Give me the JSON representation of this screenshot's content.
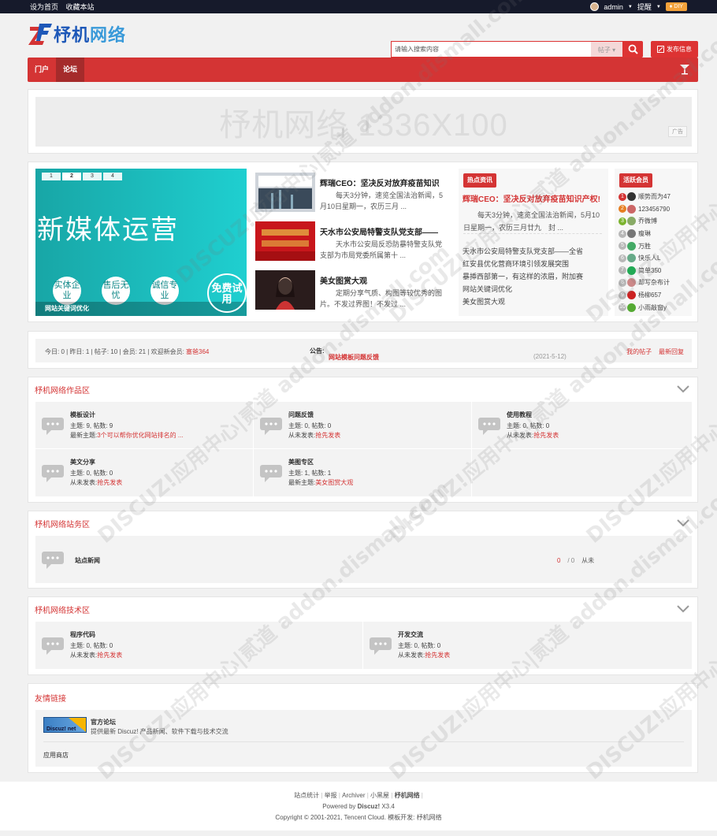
{
  "topbar": {
    "set_home": "设为首页",
    "bookmark": "收藏本站",
    "user": "admin",
    "remind": "提醒",
    "diy": "DIY"
  },
  "header": {
    "logo_text": "杼机",
    "logo_text2": "网络",
    "search_placeholder": "请输入搜索内容",
    "search_scope": "帖子",
    "post_button": "发布信息"
  },
  "nav": {
    "items": [
      "门户",
      "论坛"
    ]
  },
  "ad": {
    "text": "杼机网络 1336X100",
    "tag": "广告"
  },
  "banner": {
    "tabs": [
      "1",
      "2",
      "3",
      "4"
    ],
    "title": "新媒体运营",
    "c1": "实体企业",
    "c2": "售后无忧",
    "c3": "诚信专业",
    "free": "免费试用",
    "caption": "网站关键词优化"
  },
  "news": [
    {
      "title": "辉瑞CEO：坚决反对放弃疫苗知识",
      "desc": "每天3分钟，速览全国法治新闻，5月10日星期一，农历三月 ..."
    },
    {
      "title": "天水市公安局特警支队党支部——",
      "desc": "天水市公安局反恐防暴特警支队党支部为市局党委所属第十 ..."
    },
    {
      "title": "美女图赏大观",
      "desc": "定期分享气质、构图等较优秀的图片。不发过界图！不发过 ..."
    }
  ],
  "hot": {
    "tag": "热点资讯",
    "headline": "辉瑞CEO：坚决反对放弃疫苗知识产权!",
    "desc": "每天3分钟，速览全国法治新闻，5月10日星期一，农历三月廿九　封 ...",
    "links": [
      "天水市公安局特警支队党支部——全省",
      "红安县优化营商环境引领发展突围",
      "暴揷西部第一，有这样的浓眉，附加赛",
      "网站关键词优化",
      "美女图赏大观"
    ]
  },
  "members": {
    "tag": "活跃会员",
    "list": [
      {
        "n": "1",
        "name": "顺势而为47"
      },
      {
        "n": "2",
        "name": "123456790"
      },
      {
        "n": "3",
        "name": "乔微博"
      },
      {
        "n": "4",
        "name": "瘦琳"
      },
      {
        "n": "5",
        "name": "万胜"
      },
      {
        "n": "6",
        "name": "快乐人L"
      },
      {
        "n": "7",
        "name": "简单350"
      },
      {
        "n": "8",
        "name": "却写杂布计"
      },
      {
        "n": "9",
        "name": "杨柳657"
      },
      {
        "n": "10",
        "name": "小雨敲窗y"
      }
    ]
  },
  "stats": {
    "text": "今日: 0 | 昨日: 1 | 帖子: 10 | 会员: 21 | 欢迎新会员: ",
    "new_member": "塞爸364",
    "notice_label": "公告:",
    "notice": "网站模板问题反馈",
    "date": "(2021-5-12)",
    "my_posts": "我的帖子",
    "latest_reply": "最新回复"
  },
  "section1": {
    "title": "杼机网络作品区",
    "forums": [
      {
        "name": "模板设计",
        "stats": "主题: 9, 帖数: 9",
        "last_label": "最新主题:",
        "last": "3个可以帮你优化网站排名的 ..."
      },
      {
        "name": "问题反馈",
        "stats": "主题: 0, 帖数: 0",
        "last_label": "从未发表:",
        "last": "抢先发表"
      },
      {
        "name": "使用教程",
        "stats": "主题: 0, 帖数: 0",
        "last_label": "从未发表:",
        "last": "抢先发表"
      },
      {
        "name": "美文分享",
        "stats": "主题: 0, 帖数: 0",
        "last_label": "从未发表:",
        "last": "抢先发表"
      },
      {
        "name": "美图专区",
        "stats": "主题: 1, 帖数: 1",
        "last_label": "最新主题:",
        "last": "美女图赏大观"
      }
    ]
  },
  "section2": {
    "title": "杼机网络站务区",
    "forum": "站点新闻",
    "c1": "0",
    "c2": "/ 0",
    "never": "从未"
  },
  "section3": {
    "title": "杼机网络技术区",
    "forums": [
      {
        "name": "程序代码",
        "stats": "主题: 0, 帖数: 0",
        "last_label": "从未发表:",
        "last": "抢先发表"
      },
      {
        "name": "开发交流",
        "stats": "主题: 0, 帖数: 0",
        "last_label": "从未发表:",
        "last": "抢先发表"
      }
    ]
  },
  "links": {
    "title": "友情链接",
    "site_name": "官方论坛",
    "site_desc": "提供最新 Discuz! 产品新闻、软件下载与技术交流",
    "logo_text": "Discuz! net",
    "app_store": "应用商店"
  },
  "footer": {
    "links": [
      "站点统计",
      "举报",
      "Archiver",
      "小黑屋",
      "杼机网络"
    ],
    "powered_prefix": "Powered by ",
    "powered_brand": "Discuz!",
    "powered_ver": " X3.4",
    "copyright": "Copyright © 2001-2021, Tencent Cloud.  模板开发: 杼机网络"
  },
  "watermark": "DISCUZ!应用中心|贰道 addon.dismall.com",
  "colors": {
    "accent": "#d43434",
    "topbar": "#161a2b",
    "logo": "#1e58b8",
    "banner": "#1fb8b8"
  }
}
